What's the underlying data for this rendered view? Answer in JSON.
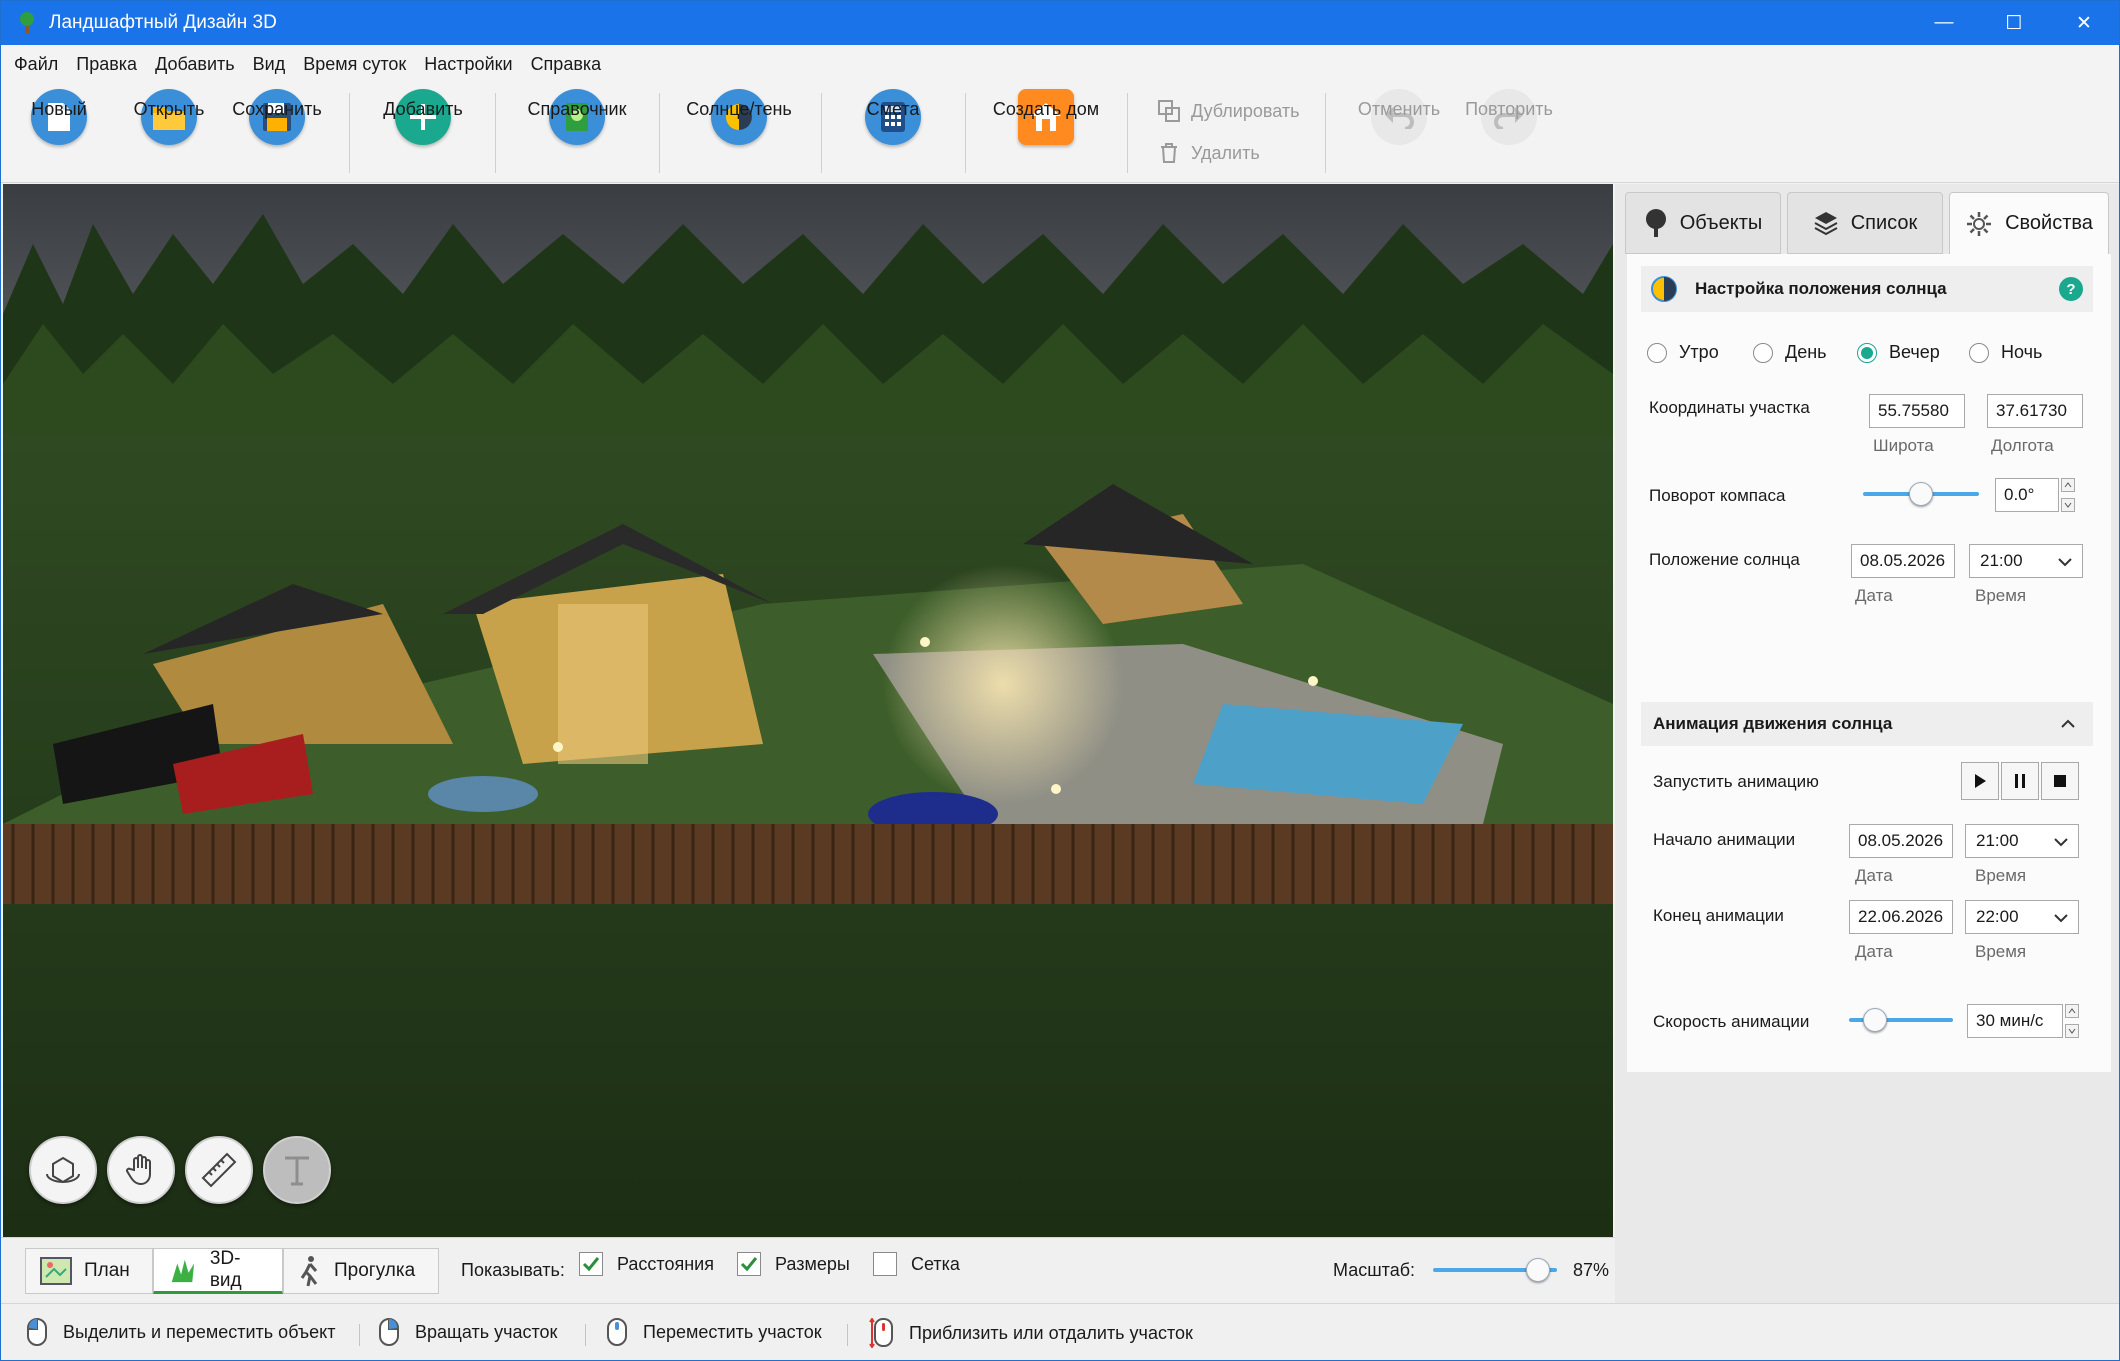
{
  "window": {
    "title": "Ландшафтный Дизайн 3D",
    "minimize": "—",
    "maximize": "☐",
    "close": "✕"
  },
  "menu": [
    "Файл",
    "Правка",
    "Добавить",
    "Вид",
    "Время суток",
    "Настройки",
    "Справка"
  ],
  "toolbar": {
    "new": "Новый",
    "open": "Открыть",
    "save": "Сохранить",
    "add": "Добавить",
    "reference": "Справочник",
    "sun_shadow": "Солнце/тень",
    "estimate": "Смета",
    "create_house": "Создать дом",
    "duplicate": "Дублировать",
    "delete": "Удалить",
    "undo": "Отменить",
    "redo": "Повторить"
  },
  "view_tabs": {
    "plan": "План",
    "view3d": "3D-вид",
    "walk": "Прогулка"
  },
  "show": {
    "label": "Показывать:",
    "distances": "Расстояния",
    "distances_checked": true,
    "sizes": "Размеры",
    "sizes_checked": true,
    "grid": "Сетка",
    "grid_checked": false
  },
  "zoom": {
    "label": "Масштаб:",
    "value": "87%",
    "level": 0.87
  },
  "status": {
    "select_move": "Выделить и переместить объект",
    "rotate": "Вращать участок",
    "move_plot": "Переместить участок",
    "zoom": "Приблизить или отдалить участок"
  },
  "panel": {
    "tabs": {
      "objects": "Объекты",
      "list": "Список",
      "properties": "Свойства"
    },
    "header": "Настройка положения солнца",
    "help": "?",
    "time_of_day": {
      "morning": "Утро",
      "day": "День",
      "evening": "Вечер",
      "night": "Ночь",
      "selected": "evening"
    },
    "coords_label": "Координаты участка",
    "latitude": "55.75580",
    "latitude_label": "Широта",
    "longitude": "37.61730",
    "longitude_label": "Долгота",
    "compass_label": "Поворот компаса",
    "compass_value": "0.0°",
    "compass_level": 0.5,
    "sun_pos_label": "Положение солнца",
    "sun_date": "08.05.2026",
    "sun_time": "21:00",
    "date_label": "Дата",
    "time_label": "Время",
    "anim_header": "Анимация движения солнца",
    "start_anim_label": "Запустить анимацию",
    "anim_start_label": "Начало анимации",
    "anim_start_date": "08.05.2026",
    "anim_start_time": "21:00",
    "anim_end_label": "Конец анимации",
    "anim_end_date": "22.06.2026",
    "anim_end_time": "22:00",
    "speed_label": "Скорость анимации",
    "speed_value": "30 мин/с",
    "speed_level": 0.25
  }
}
